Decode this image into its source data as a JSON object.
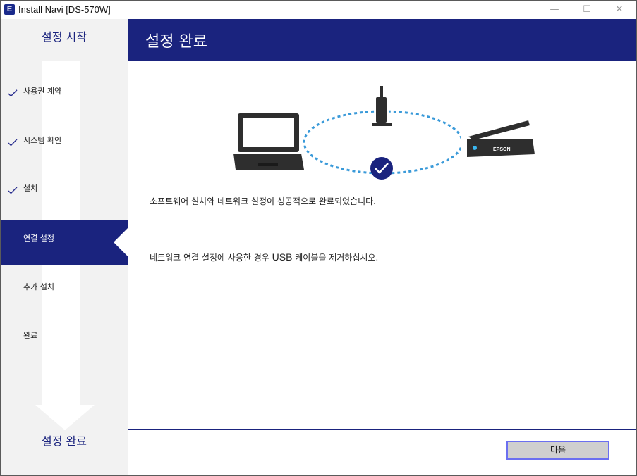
{
  "window": {
    "title": "Install Navi [DS-570W]",
    "app_icon_letter": "E",
    "minimize_glyph": "—",
    "maximize_glyph": "☐",
    "close_glyph": "✕"
  },
  "sidebar": {
    "start_label": "설정 시작",
    "end_label": "설정 완료",
    "steps": [
      {
        "label": "사용권 계약",
        "status": "done"
      },
      {
        "label": "시스템 확인",
        "status": "done"
      },
      {
        "label": "설치",
        "status": "done"
      },
      {
        "label": "연결 설정",
        "status": "current"
      },
      {
        "label": "추가 설치",
        "status": "pending"
      },
      {
        "label": "완료",
        "status": "pending"
      }
    ]
  },
  "main": {
    "header_title": "설정 완료",
    "illustration": {
      "scanner_brand": "EPSON",
      "icons": [
        "laptop-icon",
        "router-icon",
        "scanner-icon",
        "success-check-icon"
      ]
    },
    "message_success": "소프트웨어 설치와 네트워크 설정이 성공적으로 완료되었습니다.",
    "message_usb_before": "네트워크 연결 설정에 사용한 경우 ",
    "message_usb_highlight": "USB",
    "message_usb_after": " 케이블을 제거하십시오."
  },
  "footer": {
    "next_label": "다음"
  },
  "colors": {
    "brand_navy": "#1a237e",
    "connection_dots": "#3a9ad9",
    "button_focus_border": "#6b6ff0"
  }
}
